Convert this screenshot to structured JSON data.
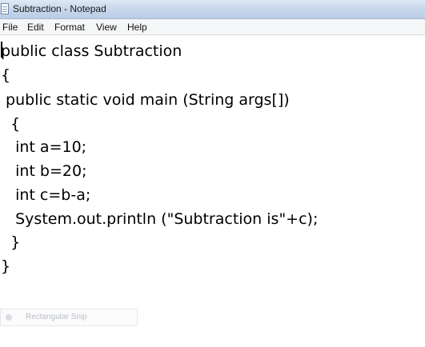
{
  "window": {
    "title": "Subtraction - Notepad"
  },
  "menu": {
    "items": [
      {
        "label": "File"
      },
      {
        "label": "Edit"
      },
      {
        "label": "Format"
      },
      {
        "label": "View"
      },
      {
        "label": "Help"
      }
    ]
  },
  "editor": {
    "lines": [
      "public class Subtraction",
      "{",
      " public static void main (String args[])",
      "  {",
      "   int a=10;",
      "   int b=20;",
      "   int c=b-a;",
      "   System.out.println (\"Subtraction is\"+c);",
      "  }",
      "}"
    ]
  },
  "overlay": {
    "snip_label": "Rectangular Snip"
  },
  "icons": {
    "app": "notepad-icon",
    "snip": "snip-mode-icon"
  }
}
